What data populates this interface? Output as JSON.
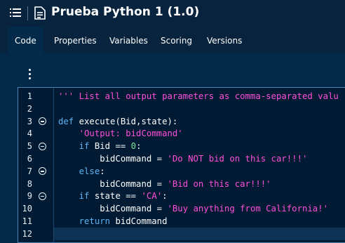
{
  "header": {
    "title": "Prueba Python 1 (1.0)",
    "menu_icon": "hamburger-list-icon",
    "doc_icon": "document-edit-icon"
  },
  "tabs": [
    {
      "label": "Code",
      "active": true
    },
    {
      "label": "Properties",
      "active": false
    },
    {
      "label": "Variables",
      "active": false
    },
    {
      "label": "Scoring",
      "active": false
    },
    {
      "label": "Versions",
      "active": false
    }
  ],
  "toolbar": {
    "more_icon": "more-vertical-icon"
  },
  "editor": {
    "lines": [
      {
        "num": "1",
        "fold": false,
        "tokens": [
          {
            "t": "''' List all output parameters as comma-separated valu",
            "c": "str"
          }
        ]
      },
      {
        "num": "2",
        "fold": false,
        "tokens": []
      },
      {
        "num": "3",
        "fold": true,
        "tokens": [
          {
            "t": "def",
            "c": "kw"
          },
          {
            "t": " execute(Bid,state):",
            "c": "plain"
          }
        ]
      },
      {
        "num": "4",
        "fold": false,
        "tokens": [
          {
            "t": "    ",
            "c": "plain"
          },
          {
            "t": "'Output: bidCommand'",
            "c": "str"
          }
        ]
      },
      {
        "num": "5",
        "fold": true,
        "tokens": [
          {
            "t": "    ",
            "c": "plain"
          },
          {
            "t": "if",
            "c": "kw"
          },
          {
            "t": " Bid == ",
            "c": "plain"
          },
          {
            "t": "0",
            "c": "num"
          },
          {
            "t": ":",
            "c": "plain"
          }
        ]
      },
      {
        "num": "6",
        "fold": false,
        "tokens": [
          {
            "t": "        bidCommand = ",
            "c": "plain"
          },
          {
            "t": "'Do NOT bid on this car!!!'",
            "c": "str"
          }
        ]
      },
      {
        "num": "7",
        "fold": true,
        "tokens": [
          {
            "t": "    ",
            "c": "plain"
          },
          {
            "t": "else",
            "c": "kw"
          },
          {
            "t": ":",
            "c": "plain"
          }
        ]
      },
      {
        "num": "8",
        "fold": false,
        "tokens": [
          {
            "t": "        bidCommand = ",
            "c": "plain"
          },
          {
            "t": "'Bid on this car!!!'",
            "c": "str"
          }
        ]
      },
      {
        "num": "9",
        "fold": true,
        "tokens": [
          {
            "t": "    ",
            "c": "plain"
          },
          {
            "t": "if",
            "c": "kw"
          },
          {
            "t": " state == ",
            "c": "plain"
          },
          {
            "t": "'CA'",
            "c": "str"
          },
          {
            "t": ":",
            "c": "plain"
          }
        ]
      },
      {
        "num": "10",
        "fold": false,
        "tokens": [
          {
            "t": "        bidCommand = ",
            "c": "plain"
          },
          {
            "t": "'Buy anything from California!'",
            "c": "str"
          }
        ]
      },
      {
        "num": "11",
        "fold": false,
        "tokens": [
          {
            "t": "    ",
            "c": "plain"
          },
          {
            "t": "return",
            "c": "kw"
          },
          {
            "t": " bidCommand",
            "c": "plain"
          }
        ]
      },
      {
        "num": "12",
        "fold": false,
        "tokens": []
      }
    ],
    "current_line": 12
  }
}
